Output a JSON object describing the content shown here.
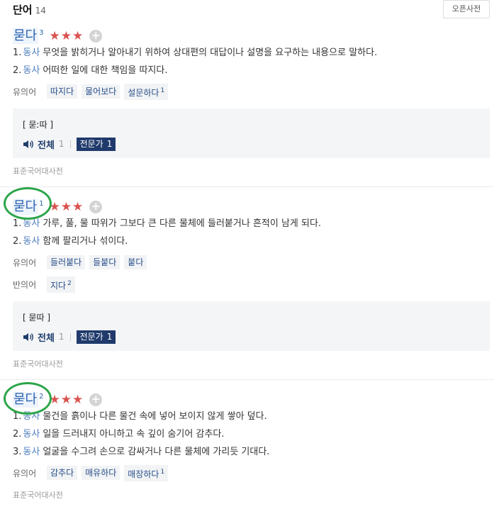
{
  "header": {
    "title": "단어",
    "count": "14",
    "open_dict_label": "오픈사전"
  },
  "entries": [
    {
      "word": "묻다",
      "homonym": "3",
      "stars": "★★★",
      "add": "+",
      "defs": [
        {
          "num": "1.",
          "pos": "동사",
          "text": "무엇을 밝히거나 알아내기 위하여 상대편의 대답이나 설명을 요구하는 내용으로 말하다."
        },
        {
          "num": "2.",
          "pos": "동사",
          "text": "어떠한 일에 대한 책임을 따지다."
        }
      ],
      "syn_label": "유의어",
      "synonyms": [
        {
          "w": "따지다",
          "sup": ""
        },
        {
          "w": "물어보다",
          "sup": ""
        },
        {
          "w": "설문하다",
          "sup": "1"
        }
      ],
      "pron": "[ 묻ː따 ]",
      "pron_all": "전체",
      "pron_count": "1",
      "expert": "전문가",
      "expert_count": "1",
      "source": "표준국어대사전"
    },
    {
      "word": "묻다",
      "homonym": "1",
      "stars": "★★★",
      "add": "+",
      "defs": [
        {
          "num": "1.",
          "pos": "동사",
          "text": "가루, 풀, 물 따위가 그보다 큰 다른 물체에 들러붙거나 흔적이 남게 되다."
        },
        {
          "num": "2.",
          "pos": "동사",
          "text": "함께 팔리거나 섞이다."
        }
      ],
      "syn_label": "유의어",
      "synonyms": [
        {
          "w": "들러붙다",
          "sup": ""
        },
        {
          "w": "들붙다",
          "sup": ""
        },
        {
          "w": "붙다",
          "sup": ""
        }
      ],
      "ant_label": "반의어",
      "antonyms": [
        {
          "w": "지다",
          "sup": "2"
        }
      ],
      "pron": "[ 묻따 ]",
      "pron_all": "전체",
      "pron_count": "1",
      "expert": "전문가",
      "expert_count": "1",
      "source": "표준국어대사전"
    },
    {
      "word": "묻다",
      "homonym": "2",
      "stars": "★★★",
      "add": "+",
      "defs": [
        {
          "num": "1.",
          "pos": "동사",
          "text": "물건을 흙이나 다른 물건 속에 넣어 보이지 않게 쌓아 덮다."
        },
        {
          "num": "2.",
          "pos": "동사",
          "text": "일을 드러내지 아니하고 속 깊이 숨기어 감추다."
        },
        {
          "num": "3.",
          "pos": "동사",
          "text": "얼굴을 수그려 손으로 감싸거나 다른 물체에 가리듯 기대다."
        }
      ],
      "syn_label": "유의어",
      "synonyms": [
        {
          "w": "감추다",
          "sup": ""
        },
        {
          "w": "매유하다",
          "sup": ""
        },
        {
          "w": "매장하다",
          "sup": "1"
        }
      ],
      "source": "표준국어대사전"
    }
  ],
  "colors": {
    "link": "#2a62b0",
    "star": "#d9534f",
    "expert_bg": "#1f3a6b",
    "annotation_circle": "#2ca54a"
  }
}
